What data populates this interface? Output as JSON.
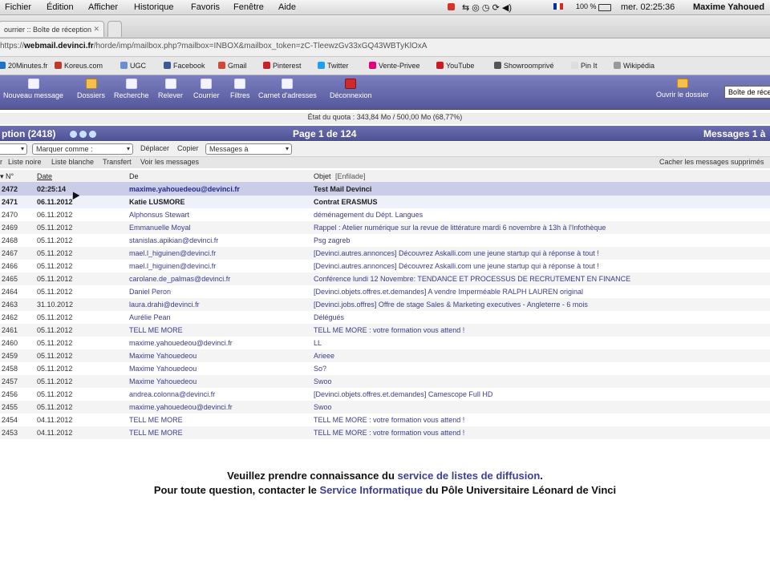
{
  "menubar": {
    "items": [
      "Fichier",
      "Édition",
      "Afficher",
      "Historique",
      "Favoris",
      "Fenêtre",
      "Aide"
    ],
    "battery": "100 %",
    "clock": "mer. 02:25:36",
    "user": "Maxime Yahoued"
  },
  "tabs": [
    {
      "label": "ourrier :: Boîte de réception"
    },
    {
      "label": ""
    }
  ],
  "address": {
    "prefix": "https://",
    "host": "webmail.devinci.fr",
    "path": "/horde/imp/mailbox.php?mailbox=INBOX&mailbox_token=zC-TleewzGv33xGQ43WBTyKlOxA"
  },
  "bookmarks": [
    "20Minutes.fr",
    "Koreus.com",
    "UGC",
    "Facebook",
    "Gmail",
    "Pinterest",
    "Twitter",
    "Vente-Privee",
    "YouTube",
    "Showroomprivé",
    "Pin It",
    "Wikipédia"
  ],
  "bookmark_colors": [
    "#1a73c9",
    "#c0392b",
    "#6a8fd0",
    "#3b5998",
    "#d14836",
    "#cb2027",
    "#1da1f2",
    "#e4007c",
    "#cc181e",
    "#555555",
    "#dddddd",
    "#999999"
  ],
  "toolbar": {
    "items": [
      "Nouveau message",
      "Dossiers",
      "Recherche",
      "Relever",
      "Courrier",
      "Filtres",
      "Carnet d'adresses",
      "Déconnexion"
    ],
    "open_folder": "Ouvrir le dossier",
    "folder_select": "Boîte de réception"
  },
  "quota": "État du quota : 343,84 Mo / 500,00 Mo (68,77%)",
  "mailbox": {
    "title": "ption (2418)",
    "page": "Page 1 de 124",
    "messages": "Messages 1 à"
  },
  "controls": {
    "select_empty": "",
    "mark_as": "Marquer comme :",
    "move": "Déplacer",
    "copy": "Copier",
    "messages_to": "Messages à"
  },
  "filters": [
    "Liste noire",
    "Liste blanche",
    "Transfert",
    "Voir les messages"
  ],
  "filters_lead": "r",
  "hide_deleted": "Cacher les messages supprimés",
  "columns": {
    "num": "N°",
    "date": "Date",
    "from": "De",
    "subject": "Objet",
    "thread": "[Enfilade]"
  },
  "messages": [
    {
      "num": "2472",
      "date": "02:25:14",
      "from": "maxime.yahouedeou@devinci.fr",
      "subject": "Test Mail Devinci"
    },
    {
      "num": "2471",
      "date": "06.11.2012",
      "from": "Katie LUSMORE",
      "subject": "Contrat ERASMUS"
    },
    {
      "num": "2470",
      "date": "06.11.2012",
      "from": "Alphonsus Stewart",
      "subject": "déménagement du Dépt. Langues"
    },
    {
      "num": "2469",
      "date": "05.11.2012",
      "from": "Emmanuelle Moyal",
      "subject": "Rappel : Atelier numérique sur la revue de littérature mardi 6 novembre à 13h à l'Infothèque"
    },
    {
      "num": "2468",
      "date": "05.11.2012",
      "from": "stanislas.apikian@devinci.fr",
      "subject": "Psg zagreb"
    },
    {
      "num": "2467",
      "date": "05.11.2012",
      "from": "mael.l_higuinen@devinci.fr",
      "subject": "[Devinci.autres.annonces] Découvrez Askalli.com une jeune startup qui à réponse à tout !"
    },
    {
      "num": "2466",
      "date": "05.11.2012",
      "from": "mael.l_higuinen@devinci.fr",
      "subject": "[Devinci.autres.annonces] Découvrez Askalli.com une jeune startup qui à réponse à tout !"
    },
    {
      "num": "2465",
      "date": "05.11.2012",
      "from": "carolane.de_palmas@devinci.fr",
      "subject": "Conférence lundi 12 Novembre: TENDANCE ET PROCESSUS DE RECRUTEMENT EN FINANCE"
    },
    {
      "num": "2464",
      "date": "05.11.2012",
      "from": "Daniel Peron",
      "subject": "[Devinci.objets.offres.et.demandes] A vendre Imperméable RALPH LAUREN original"
    },
    {
      "num": "2463",
      "date": "31.10.2012",
      "from": "laura.drahi@devinci.fr",
      "subject": "[Devinci.jobs.offres] Offre de stage Sales & Marketing executives - Angleterre - 6 mois"
    },
    {
      "num": "2462",
      "date": "05.11.2012",
      "from": "Aurélie Pean",
      "subject": "Délégués"
    },
    {
      "num": "2461",
      "date": "05.11.2012",
      "from": "TELL ME MORE",
      "subject": "TELL ME MORE : votre formation vous attend !"
    },
    {
      "num": "2460",
      "date": "05.11.2012",
      "from": "maxime.yahouedeou@devinci.fr",
      "subject": "LL"
    },
    {
      "num": "2459",
      "date": "05.11.2012",
      "from": "Maxime Yahouedeou",
      "subject": "Arieee"
    },
    {
      "num": "2458",
      "date": "05.11.2012",
      "from": "Maxime Yahouedeou",
      "subject": "So?"
    },
    {
      "num": "2457",
      "date": "05.11.2012",
      "from": "Maxime Yahouedeou",
      "subject": "Swoo"
    },
    {
      "num": "2456",
      "date": "05.11.2012",
      "from": "andrea.colonna@devinci.fr",
      "subject": "[Devinci.objets.offres.et.demandes] Camescope Full HD"
    },
    {
      "num": "2455",
      "date": "05.11.2012",
      "from": "maxime.yahouedeou@devinci.fr",
      "subject": "Swoo"
    },
    {
      "num": "2454",
      "date": "04.11.2012",
      "from": "TELL ME MORE",
      "subject": "TELL ME MORE : votre formation vous attend !"
    },
    {
      "num": "2453",
      "date": "04.11.2012",
      "from": "TELL ME MORE",
      "subject": "TELL ME MORE : votre formation vous attend !"
    }
  ],
  "footer": {
    "line1_pre": "Veuillez prendre connaissance du",
    "line1_link": "service de listes de diffusion",
    "line1_post": ".",
    "line2_pre": "Pour toute question, contacter le",
    "line2_link": "Service Informatique",
    "line2_post": "du Pôle Universitaire Léonard de Vinci"
  }
}
